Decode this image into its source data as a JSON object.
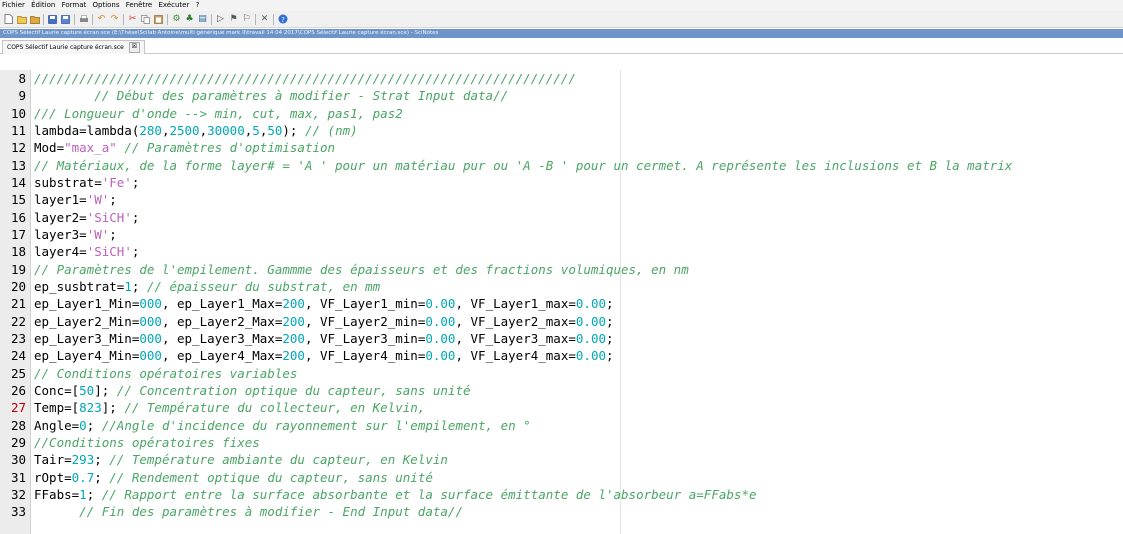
{
  "menubar": {
    "items": [
      "Fichier",
      "Édition",
      "Format",
      "Options",
      "Fenêtre",
      "Exécuter",
      "?"
    ]
  },
  "toolbar": {
    "icons": [
      "new-file-icon",
      "open-file-icon",
      "open-folder-icon",
      "save-icon",
      "save-as-icon",
      "print-icon",
      "undo-icon",
      "redo-icon",
      "cut-icon",
      "copy-icon",
      "paste-icon",
      "execute-icon",
      "execute-file-icon",
      "execute-echo-icon",
      "run-icon",
      "debug-icon",
      "stop-icon",
      "close-icon",
      "help-icon"
    ]
  },
  "window": {
    "title": "COPS Sélectif Laurie capture écran.sce (E:\\Thèse\\Scilab Antoine\\multi générique mark II\\travail 14 04 2017\\COPS Sélectif Laurie capture écran.sce) - SciNotes"
  },
  "tab": {
    "label": "COPS Sélectif Laurie capture écran.sce",
    "close": "☒"
  },
  "editor": {
    "lines": [
      {
        "n": "8",
        "segs": [
          {
            "t": "c",
            "v": "////////////////////////////////////////////////////////////////////////"
          }
        ]
      },
      {
        "n": "9",
        "segs": [
          {
            "t": "p",
            "v": "        "
          },
          {
            "t": "c",
            "v": "// Début des paramètres à modifier - Strat Input data//"
          }
        ]
      },
      {
        "n": "10",
        "segs": [
          {
            "t": "c",
            "v": "/// Longueur d'onde --> min, cut, max, pas1, pas2"
          }
        ]
      },
      {
        "n": "11",
        "segs": [
          {
            "t": "p",
            "v": "lambda=lambda("
          },
          {
            "t": "n",
            "v": "280"
          },
          {
            "t": "p",
            "v": ","
          },
          {
            "t": "n",
            "v": "2500"
          },
          {
            "t": "p",
            "v": ","
          },
          {
            "t": "n",
            "v": "30000"
          },
          {
            "t": "p",
            "v": ","
          },
          {
            "t": "n",
            "v": "5"
          },
          {
            "t": "p",
            "v": ","
          },
          {
            "t": "n",
            "v": "50"
          },
          {
            "t": "p",
            "v": "); "
          },
          {
            "t": "c",
            "v": "// (nm)"
          }
        ]
      },
      {
        "n": "12",
        "segs": [
          {
            "t": "p",
            "v": "Mod="
          },
          {
            "t": "s",
            "v": "\"max_a\""
          },
          {
            "t": "p",
            "v": " "
          },
          {
            "t": "c",
            "v": "// Paramètres d'optimisation"
          }
        ]
      },
      {
        "n": "13",
        "segs": [
          {
            "t": "c",
            "v": "// Matériaux, de la forme layer# = 'A ' pour un matériau pur ou 'A -B ' pour un cermet. A représente les inclusions et B la matrix"
          }
        ]
      },
      {
        "n": "14",
        "segs": [
          {
            "t": "p",
            "v": "substrat="
          },
          {
            "t": "s",
            "v": "'Fe'"
          },
          {
            "t": "p",
            "v": ";"
          }
        ]
      },
      {
        "n": "15",
        "segs": [
          {
            "t": "p",
            "v": "layer1="
          },
          {
            "t": "s",
            "v": "'W'"
          },
          {
            "t": "p",
            "v": ";"
          }
        ]
      },
      {
        "n": "16",
        "segs": [
          {
            "t": "p",
            "v": "layer2="
          },
          {
            "t": "s",
            "v": "'SiCH'"
          },
          {
            "t": "p",
            "v": ";"
          }
        ]
      },
      {
        "n": "17",
        "segs": [
          {
            "t": "p",
            "v": "layer3="
          },
          {
            "t": "s",
            "v": "'W'"
          },
          {
            "t": "p",
            "v": ";"
          }
        ]
      },
      {
        "n": "18",
        "segs": [
          {
            "t": "p",
            "v": "layer4="
          },
          {
            "t": "s",
            "v": "'SiCH'"
          },
          {
            "t": "p",
            "v": ";"
          }
        ]
      },
      {
        "n": "19",
        "segs": [
          {
            "t": "c",
            "v": "// Paramètres de l'empilement. Gammme des épaisseurs et des fractions volumiques, en nm"
          }
        ]
      },
      {
        "n": "20",
        "segs": [
          {
            "t": "p",
            "v": "ep_susbtrat="
          },
          {
            "t": "n",
            "v": "1"
          },
          {
            "t": "p",
            "v": "; "
          },
          {
            "t": "c",
            "v": "// épaisseur du substrat, en mm"
          }
        ]
      },
      {
        "n": "21",
        "segs": [
          {
            "t": "p",
            "v": "ep_Layer1_Min="
          },
          {
            "t": "n",
            "v": "000"
          },
          {
            "t": "p",
            "v": ", ep_Layer1_Max="
          },
          {
            "t": "n",
            "v": "200"
          },
          {
            "t": "p",
            "v": ", VF_Layer1_min="
          },
          {
            "t": "n",
            "v": "0.00"
          },
          {
            "t": "p",
            "v": ", VF_Layer1_max="
          },
          {
            "t": "n",
            "v": "0.00"
          },
          {
            "t": "p",
            "v": ";"
          }
        ]
      },
      {
        "n": "22",
        "segs": [
          {
            "t": "p",
            "v": "ep_Layer2_Min="
          },
          {
            "t": "n",
            "v": "000"
          },
          {
            "t": "p",
            "v": ", ep_Layer2_Max="
          },
          {
            "t": "n",
            "v": "200"
          },
          {
            "t": "p",
            "v": ", VF_Layer2_min="
          },
          {
            "t": "n",
            "v": "0.00"
          },
          {
            "t": "p",
            "v": ", VF_Layer2_max="
          },
          {
            "t": "n",
            "v": "0.00"
          },
          {
            "t": "p",
            "v": ";"
          }
        ]
      },
      {
        "n": "23",
        "segs": [
          {
            "t": "p",
            "v": "ep_Layer3_Min="
          },
          {
            "t": "n",
            "v": "000"
          },
          {
            "t": "p",
            "v": ", ep_Layer3_Max="
          },
          {
            "t": "n",
            "v": "200"
          },
          {
            "t": "p",
            "v": ", VF_Layer3_min="
          },
          {
            "t": "n",
            "v": "0.00"
          },
          {
            "t": "p",
            "v": ", VF_Layer3_max="
          },
          {
            "t": "n",
            "v": "0.00"
          },
          {
            "t": "p",
            "v": ";"
          }
        ]
      },
      {
        "n": "24",
        "segs": [
          {
            "t": "p",
            "v": "ep_Layer4_Min="
          },
          {
            "t": "n",
            "v": "000"
          },
          {
            "t": "p",
            "v": ", ep_Layer4_Max="
          },
          {
            "t": "n",
            "v": "200"
          },
          {
            "t": "p",
            "v": ", VF_Layer4_min="
          },
          {
            "t": "n",
            "v": "0.00"
          },
          {
            "t": "p",
            "v": ", VF_Layer4_max="
          },
          {
            "t": "n",
            "v": "0.00"
          },
          {
            "t": "p",
            "v": ";"
          }
        ]
      },
      {
        "n": "25",
        "segs": [
          {
            "t": "c",
            "v": "// Conditions opératoires variables"
          }
        ]
      },
      {
        "n": "26",
        "segs": [
          {
            "t": "p",
            "v": "Conc=["
          },
          {
            "t": "n",
            "v": "50"
          },
          {
            "t": "p",
            "v": "]; "
          },
          {
            "t": "c",
            "v": "// Concentration optique du capteur, sans unité"
          }
        ]
      },
      {
        "n": "27",
        "mark": true,
        "segs": [
          {
            "t": "p",
            "v": "Temp=["
          },
          {
            "t": "n",
            "v": "823"
          },
          {
            "t": "p",
            "v": "]; "
          },
          {
            "t": "c",
            "v": "// Température du collecteur, en Kelvin,"
          }
        ]
      },
      {
        "n": "28",
        "segs": [
          {
            "t": "p",
            "v": "Angle="
          },
          {
            "t": "n",
            "v": "0"
          },
          {
            "t": "p",
            "v": "; "
          },
          {
            "t": "c",
            "v": "//Angle d'incidence du rayonnement sur l'empilement, en °"
          }
        ]
      },
      {
        "n": "29",
        "segs": [
          {
            "t": "c",
            "v": "//Conditions opératoires fixes"
          }
        ]
      },
      {
        "n": "30",
        "segs": [
          {
            "t": "p",
            "v": "Tair="
          },
          {
            "t": "n",
            "v": "293"
          },
          {
            "t": "p",
            "v": "; "
          },
          {
            "t": "c",
            "v": "// Température ambiante du capteur, en Kelvin"
          }
        ]
      },
      {
        "n": "31",
        "segs": [
          {
            "t": "p",
            "v": "rOpt="
          },
          {
            "t": "n",
            "v": "0.7"
          },
          {
            "t": "p",
            "v": "; "
          },
          {
            "t": "c",
            "v": "// Rendement optique du capteur, sans unité"
          }
        ]
      },
      {
        "n": "32",
        "segs": [
          {
            "t": "p",
            "v": "FFabs="
          },
          {
            "t": "n",
            "v": "1"
          },
          {
            "t": "p",
            "v": "; "
          },
          {
            "t": "c",
            "v": "// Rapport entre la surface absorbante et la surface émittante de l'absorbeur a=FFabs*e"
          }
        ]
      },
      {
        "n": "33",
        "segs": [
          {
            "t": "p",
            "v": "      "
          },
          {
            "t": "c",
            "v": "// Fin des paramètres à modifier - End Input data//"
          }
        ]
      }
    ]
  }
}
